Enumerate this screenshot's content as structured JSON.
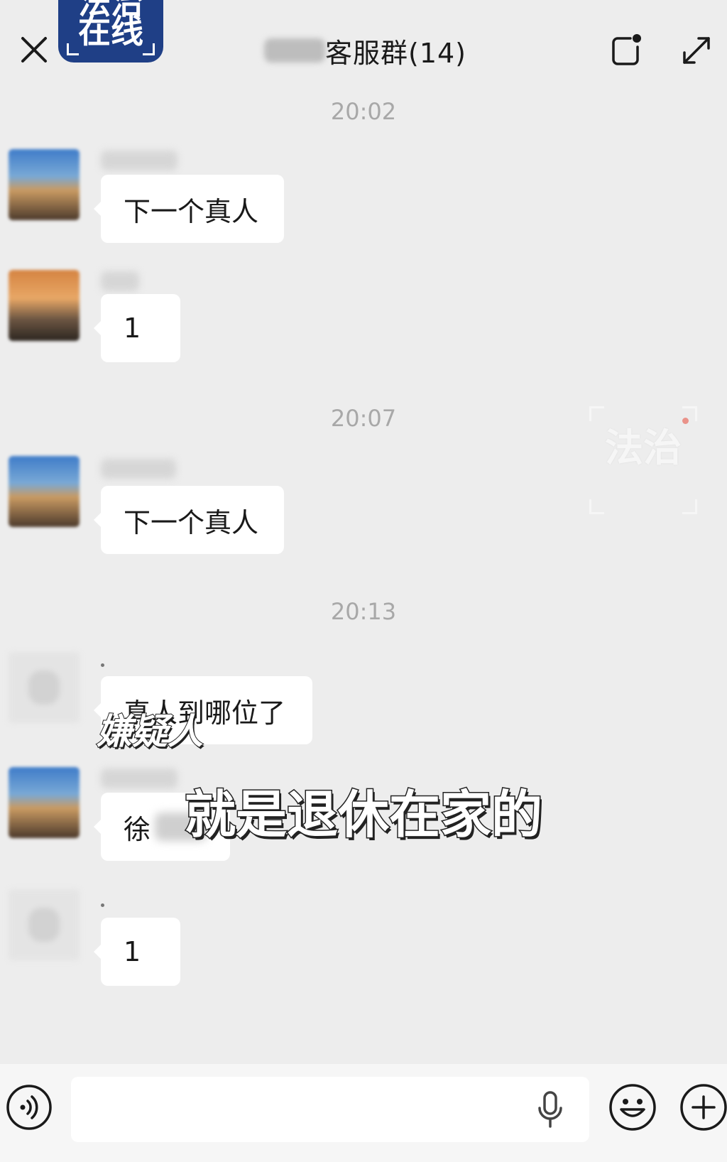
{
  "logo": {
    "line1": "法治",
    "line2": "在线"
  },
  "header": {
    "title": "客服群(14)"
  },
  "watermark": {
    "text": "法治"
  },
  "messages": [
    {
      "timestamp": "20:02",
      "text": "下一个真人"
    },
    {
      "text": "1"
    },
    {
      "timestamp": "20:07",
      "text": "下一个真人"
    },
    {
      "timestamp": "20:13",
      "text": "真人到哪位了"
    },
    {
      "text": "徐"
    },
    {
      "text": "1"
    }
  ],
  "subtitles": {
    "label": "嫌疑人",
    "main": "就是退休在家的"
  },
  "input": {
    "placeholder": ""
  }
}
